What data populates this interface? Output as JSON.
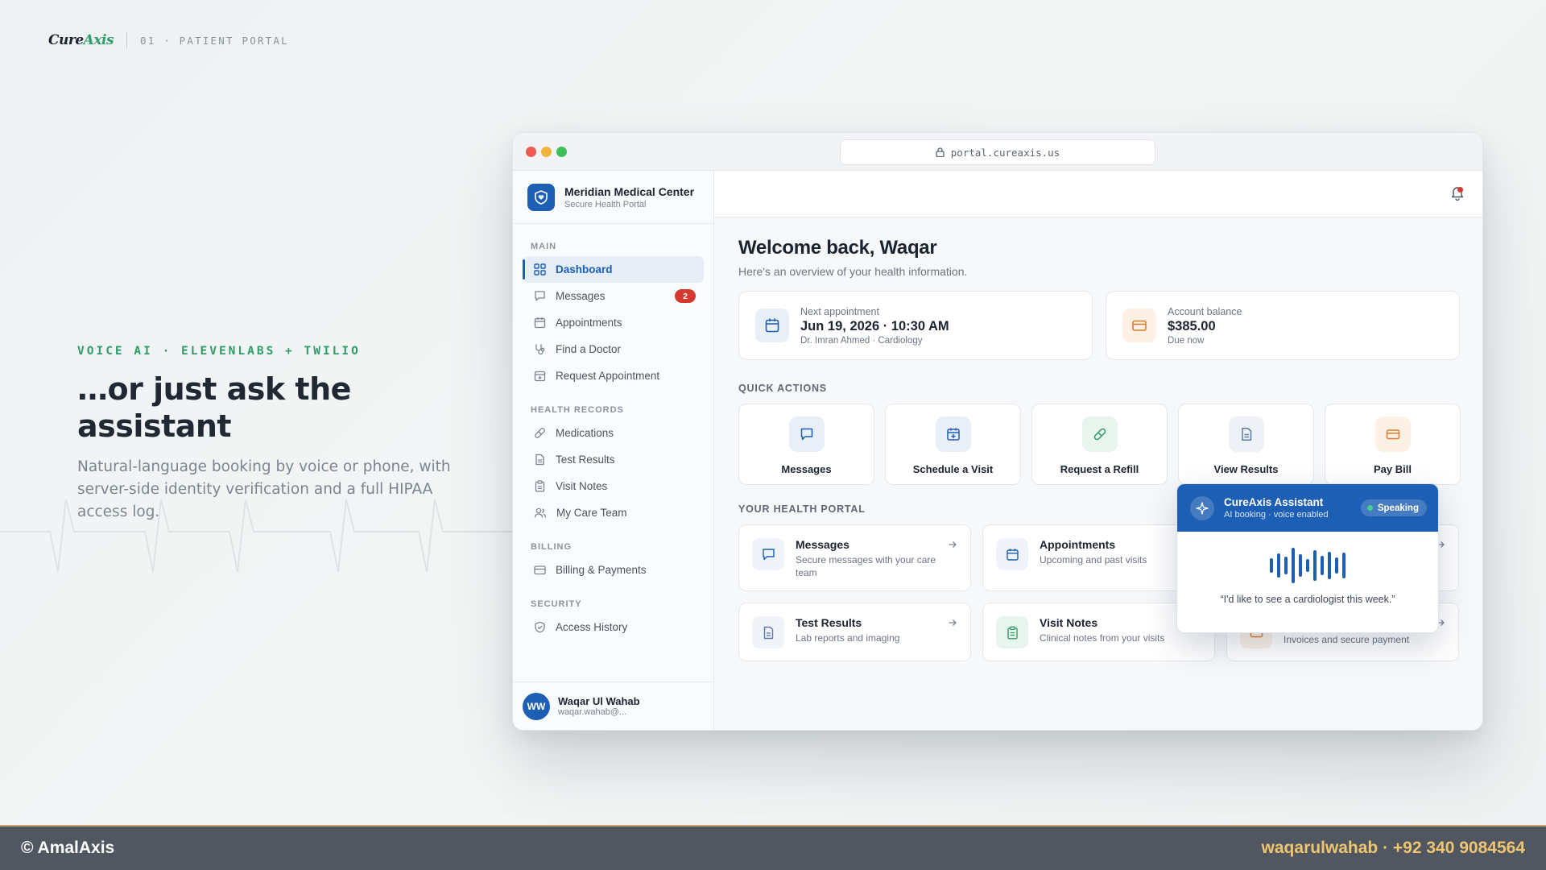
{
  "brand": {
    "logo_part1": "Cure",
    "logo_part2": "Axis",
    "tag": "01 · PATIENT PORTAL"
  },
  "hero": {
    "kicker": "VOICE AI · ELEVENLABS + TWILIO",
    "title": "…or just ask the assistant",
    "description": "Natural-language booking by voice or phone, with server-side identity verification and a full HIPAA access log."
  },
  "browser": {
    "url": "portal.cureaxis.us"
  },
  "sidebar": {
    "org_name": "Meridian Medical Center",
    "org_sub": "Secure Health Portal",
    "sections": {
      "main": "MAIN",
      "health_records": "HEALTH RECORDS",
      "billing": "BILLING",
      "security": "SECURITY"
    },
    "items": {
      "dashboard": "Dashboard",
      "messages": "Messages",
      "messages_badge": "2",
      "appointments": "Appointments",
      "find_doctor": "Find a Doctor",
      "request_appointment": "Request Appointment",
      "medications": "Medications",
      "test_results": "Test Results",
      "visit_notes": "Visit Notes",
      "care_team": "My Care Team",
      "billing_payments": "Billing & Payments",
      "access_history": "Access History"
    },
    "user": {
      "initials": "WW",
      "name": "Waqar Ul Wahab",
      "email": "waqar.wahab@..."
    }
  },
  "main": {
    "welcome": "Welcome back, Waqar",
    "welcome_sub": "Here's an overview of your health information.",
    "next_appointment": {
      "label": "Next appointment",
      "value": "Jun 19, 2026 · 10:30 AM",
      "sub": "Dr. Imran Ahmed · Cardiology"
    },
    "balance": {
      "label": "Account balance",
      "value": "$385.00",
      "sub": "Due now"
    },
    "quick_actions_title": "QUICK ACTIONS",
    "quick_actions": {
      "messages": "Messages",
      "schedule": "Schedule a Visit",
      "refill": "Request a Refill",
      "results": "View Results",
      "pay": "Pay Bill"
    },
    "portal_title": "YOUR HEALTH PORTAL",
    "portal": {
      "messages_title": "Messages",
      "messages_sub": "Secure messages with your care team",
      "appointments_title": "Appointments",
      "appointments_sub": "Upcoming and past visits",
      "results_title": "Test Results",
      "results_sub": "Lab reports and imaging",
      "notes_title": "Visit Notes",
      "notes_sub": "Clinical notes from your visits",
      "billing_sub": "Invoices and secure payment"
    }
  },
  "assistant": {
    "title": "CureAxis Assistant",
    "subtitle": "AI booking · voice enabled",
    "status": "Speaking",
    "quote": "“I'd like to see a cardiologist this week.”"
  },
  "footer": {
    "left": "© AmalAxis",
    "right": "waqarulwahab · +92 340 9084564"
  },
  "colors": {
    "accent_blue": "#1d5fb4",
    "accent_green": "#2f9c6a",
    "alert_red": "#d63a2f",
    "footer_gold": "#f0c572"
  }
}
